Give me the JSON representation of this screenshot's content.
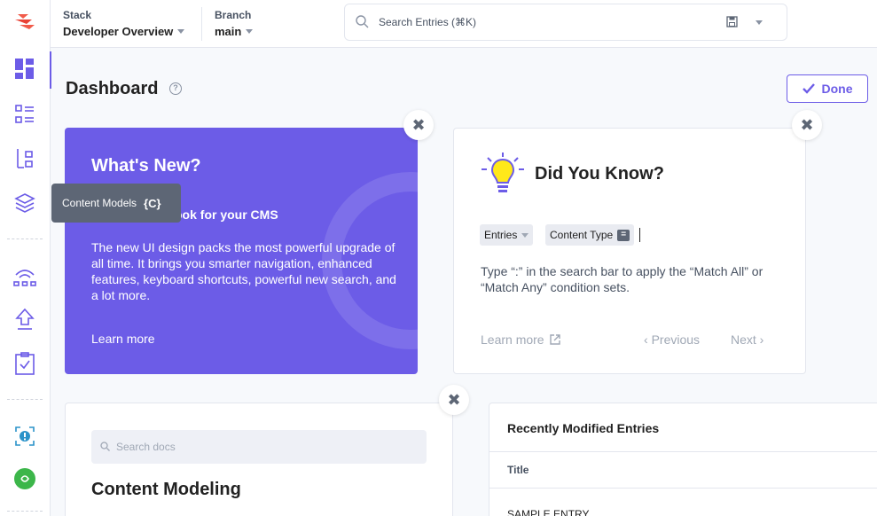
{
  "header": {
    "stack_label": "Stack",
    "stack_value": "Developer Overview",
    "branch_label": "Branch",
    "branch_value": "main",
    "search_placeholder": "Search Entries (⌘K)"
  },
  "sidebar": {
    "tooltip_label": "Content Models",
    "tooltip_shortcut": "{C}",
    "icons": [
      "dashboard-icon",
      "entries-icon",
      "assets-icon",
      "content-models-icon",
      "releases-icon",
      "deploy-icon",
      "tasks-icon",
      "help-icon",
      "apps-icon"
    ]
  },
  "page": {
    "title": "Dashboard",
    "help": "?",
    "done_label": "Done"
  },
  "whats_new": {
    "title": "What's New?",
    "subtitle_visible": "ook for your CMS",
    "body": "The new UI design packs the most powerful upgrade of all time. It brings you smarter navigation, enhanced features, keyboard shortcuts, powerful new search, and a lot more.",
    "link": "Learn more",
    "accent": "#6c5ce7"
  },
  "did_you_know": {
    "title": "Did You Know?",
    "chip_entries": "Entries",
    "chip_content_type": "Content Type",
    "eq_symbol": "=",
    "tip": "Type “:” in the search bar to apply the “Match All” or “Match Any” condition sets.",
    "learn_more": "Learn more",
    "previous": "Previous",
    "next": "Next"
  },
  "docs": {
    "search_placeholder": "Search docs",
    "title": "Content Modeling"
  },
  "recent": {
    "title": "Recently Modified Entries",
    "column_title": "Title",
    "row_1": "SAMPLE ENTRY"
  },
  "close_symbol": "✖"
}
